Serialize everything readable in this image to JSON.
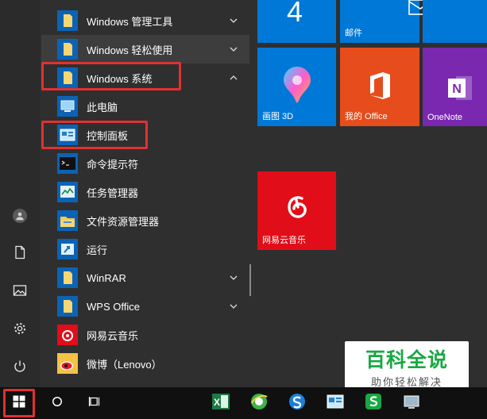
{
  "apps": [
    {
      "label": "Windows 管理工具",
      "icon": "folder-icon",
      "expandable": true,
      "expanded": false
    },
    {
      "label": "Windows 轻松使用",
      "icon": "folder-icon",
      "expandable": true,
      "expanded": false
    },
    {
      "label": "Windows 系统",
      "icon": "folder-icon",
      "expandable": true,
      "expanded": true
    },
    {
      "label": "此电脑",
      "icon": "computer-icon"
    },
    {
      "label": "控制面板",
      "icon": "control-panel-icon"
    },
    {
      "label": "命令提示符",
      "icon": "command-prompt-icon"
    },
    {
      "label": "任务管理器",
      "icon": "task-manager-icon"
    },
    {
      "label": "文件资源管理器",
      "icon": "file-explorer-icon"
    },
    {
      "label": "运行",
      "icon": "run-icon"
    },
    {
      "label": "WinRAR",
      "icon": "folder-icon",
      "expandable": true,
      "expanded": false
    },
    {
      "label": "WPS Office",
      "icon": "folder-icon",
      "expandable": true,
      "expanded": false
    },
    {
      "label": "网易云音乐",
      "icon": "netease-music-icon"
    },
    {
      "label": "微博（Lenovo）",
      "icon": "weibo-icon"
    }
  ],
  "tiles": {
    "calendar_number": "4",
    "mail": "邮件",
    "paint3d": "画图 3D",
    "office": "我的 Office",
    "onenote": "OneNote",
    "netease": "网易云音乐"
  },
  "rail": [
    "user-icon",
    "document-icon",
    "pictures-icon",
    "settings-icon",
    "power-icon"
  ],
  "taskbar": [
    "windows-start-icon",
    "search-icon",
    "task-view-icon",
    "excel-icon",
    "ie-browser-icon",
    "sogou-icon",
    "control-panel-icon",
    "wps-spreadsheet-icon",
    "system-icon"
  ],
  "watermark": {
    "title": "百科全说",
    "subtitle": "助你轻松解决"
  },
  "colors": {
    "accent": "#0078d7",
    "highlight_box": "#e03131",
    "office": "#e74c1c",
    "onenote": "#7a28b0",
    "netease": "#e10d18"
  }
}
